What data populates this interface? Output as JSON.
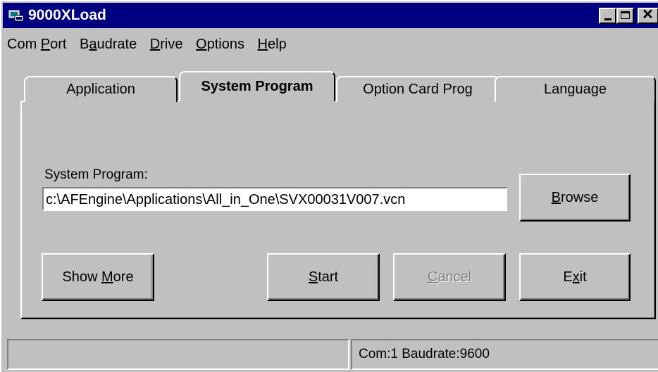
{
  "window": {
    "title": "9000XLoad"
  },
  "menu": {
    "items": [
      {
        "pre": "Com ",
        "ul": "P",
        "post": "ort"
      },
      {
        "pre": "B",
        "ul": "a",
        "post": "udrate"
      },
      {
        "pre": "",
        "ul": "D",
        "post": "rive"
      },
      {
        "pre": "",
        "ul": "O",
        "post": "ptions"
      },
      {
        "pre": "",
        "ul": "H",
        "post": "elp"
      }
    ]
  },
  "tabs": {
    "application": "Application",
    "system_program": "System Program",
    "option_card_prog": "Option Card Prog",
    "language": "Language",
    "active": "System Program"
  },
  "form": {
    "system_program_label": "System Program:",
    "system_program_path": "c:\\AFEngine\\Applications\\All_in_One\\SVX00031V007.vcn"
  },
  "buttons": {
    "browse": {
      "ul": "B",
      "post": "rowse"
    },
    "show_more": {
      "pre": "Show ",
      "ul": "M",
      "post": "ore"
    },
    "start": {
      "ul": "S",
      "post": "tart"
    },
    "cancel": {
      "ul": "C",
      "post": "ancel",
      "enabled": false
    },
    "exit": {
      "pre": "E",
      "ul": "x",
      "post": "it"
    }
  },
  "status": {
    "left": "",
    "right": "Com:1  Baudrate:9600"
  },
  "colors": {
    "titlebar": "#000080",
    "face": "#c0c0c0"
  }
}
